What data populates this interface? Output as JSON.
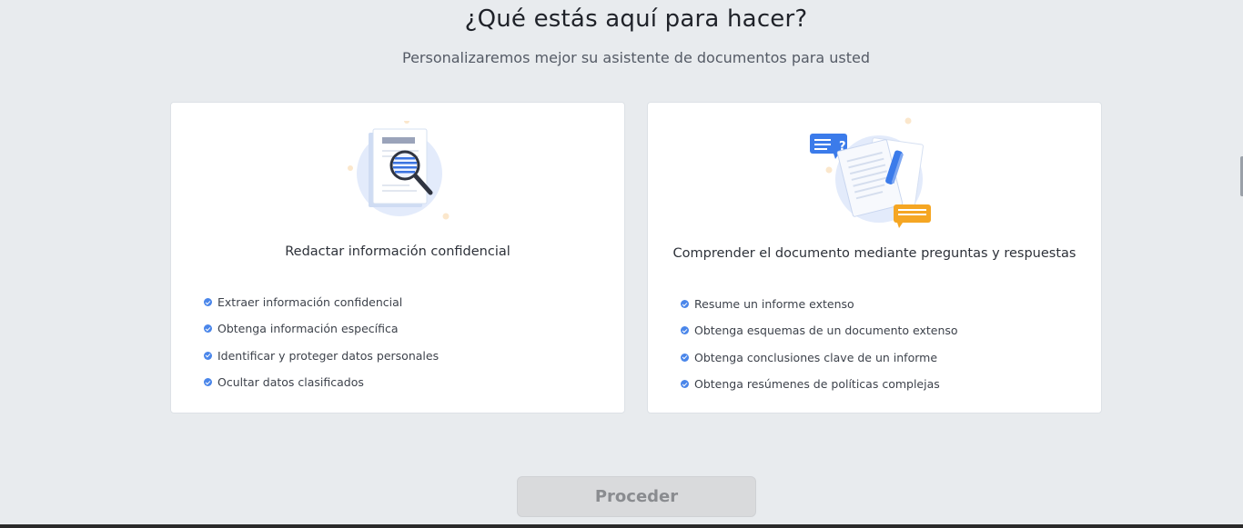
{
  "header": {
    "title": "¿Qué estás aquí para hacer?",
    "subtitle": "Personalizaremos mejor su asistente de documentos para usted"
  },
  "cards": [
    {
      "illustration": "document-magnifier-icon",
      "title": "Redactar información confidencial",
      "features": [
        "Extraer información confidencial",
        "Obtenga información específica",
        "Identificar y proteger datos personales",
        "Ocultar datos clasificados"
      ]
    },
    {
      "illustration": "document-chat-icon",
      "title": "Comprender el documento mediante preguntas y respuestas",
      "features": [
        "Resume un informe extenso",
        "Obtenga esquemas de un documento extenso",
        "Obtenga conclusiones clave de un informe",
        "Obtenga resúmenes de políticas complejas"
      ]
    }
  ],
  "proceed_label": "Proceder",
  "colors": {
    "background": "#e8ebee",
    "card": "#ffffff",
    "accent": "#4a86ea",
    "button_disabled": "#d9dadc",
    "chat_orange": "#f5a623"
  }
}
